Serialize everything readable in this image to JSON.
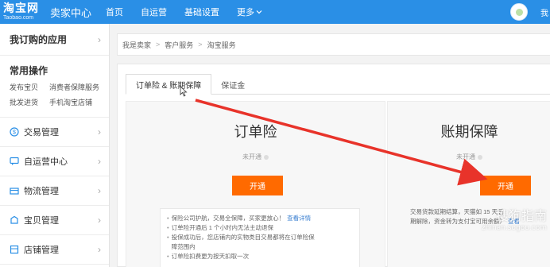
{
  "header": {
    "logo_main": "淘宝网",
    "logo_sub": "Taobao.com",
    "seller_center": "卖家中心",
    "nav": [
      "首页",
      "自运营",
      "基础设置",
      "更多"
    ],
    "user_name": "我"
  },
  "sidebar": {
    "subscribed_apps": "我订购的应用",
    "common_title": "常用操作",
    "quick_links": [
      "发布宝贝",
      "消费者保障服务",
      "批发进货",
      "手机淘宝店铺"
    ],
    "items": [
      {
        "label": "交易管理",
        "icon": "trade-icon"
      },
      {
        "label": "自运营中心",
        "icon": "chat-icon"
      },
      {
        "label": "物流管理",
        "icon": "logistics-icon"
      },
      {
        "label": "宝贝管理",
        "icon": "goods-icon"
      },
      {
        "label": "店铺管理",
        "icon": "store-icon"
      }
    ]
  },
  "breadcrumb": [
    "我是卖家",
    "客户服务",
    "淘宝服务"
  ],
  "tabs": [
    "订单险 & 账期保障",
    "保证金"
  ],
  "panels": {
    "left": {
      "title": "订单险",
      "status": "未开通",
      "button": "开通",
      "info": [
        {
          "text": "保险公司护航，交易全保障，买家更放心！",
          "link": "查看详情"
        },
        {
          "text": "订单险开通后 1 个小时内无法主动退保",
          "link": ""
        },
        {
          "text": "投保成功后，您店铺内的实物类目交易都将在订单险保",
          "link": ""
        },
        {
          "text": "障范围内",
          "link": ""
        },
        {
          "text": "订单险扣费更为按天扣取一次",
          "link": ""
        }
      ]
    },
    "right": {
      "title": "账期保障",
      "status": "未开通",
      "button": "开通",
      "info": [
        {
          "text": "交易货款延期结算，天猫如 15 天后",
          "link": ""
        },
        {
          "text": "期解除，资金转为支付宝可用余额）",
          "link": "查看"
        }
      ]
    }
  },
  "watermark": {
    "main": "搜狗指南",
    "sub": "zhinan.sogou.com"
  },
  "colors": {
    "topbar": "#2a8fe6",
    "button": "#ff6a00",
    "arrow": "#e8332a"
  }
}
